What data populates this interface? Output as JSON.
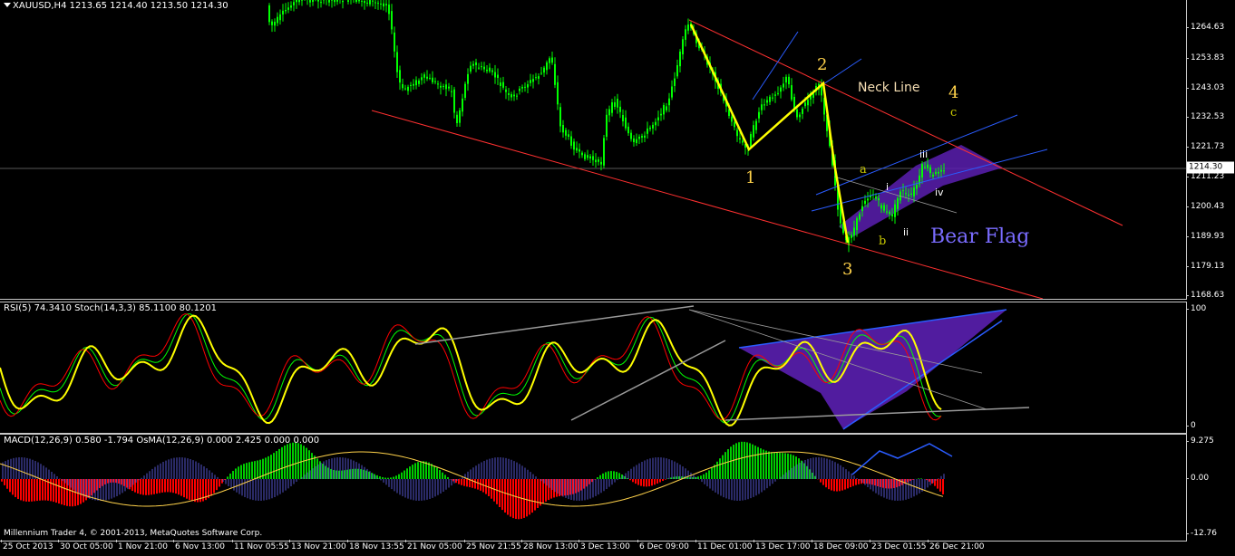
{
  "main": {
    "title": "XAUUSD,H4",
    "ohlc": "1213.65 1214.40 1213.50 1214.30",
    "price_ticks": [
      "1264.63",
      "1253.83",
      "1243.03",
      "1232.53",
      "1221.73",
      "1211.23",
      "1200.43",
      "1189.93",
      "1179.13",
      "1168.63"
    ],
    "current_price": "1214.30",
    "annotations": {
      "neck_line": "Neck Line",
      "bear_flag": "Bear Flag",
      "wave_1": "1",
      "wave_2": "2",
      "wave_3": "3",
      "wave_4": "4",
      "wave_a": "a",
      "wave_b": "b",
      "wave_c": "c",
      "wave_i": "i",
      "wave_ii": "ii",
      "wave_iii": "iii",
      "wave_iv": "iv"
    }
  },
  "rsi_pane": {
    "title": "RSI(5) 74.3410  Stoch(14,3,3) 85.1100 80.1201",
    "ticks": [
      "100",
      "0"
    ]
  },
  "macd_pane": {
    "title": "MACD(12,26,9) 0.580 -1.794  OsMA(12,26,9) 0.000 2.425 0.000 0.000",
    "ticks": [
      "9.275",
      "0.00",
      "-12.76"
    ],
    "copyright": "Millennium Trader 4, © 2001-2013, MetaQuotes Software Corp."
  },
  "time_axis": [
    "25 Oct 2013",
    "30 Oct 05:00",
    "1 Nov 21:00",
    "6 Nov 13:00",
    "11 Nov 05:55",
    "13 Nov 21:00",
    "18 Nov 13:55",
    "21 Nov 05:00",
    "25 Nov 21:55",
    "28 Nov 13:00",
    "3 Dec 13:00",
    "6 Dec 09:00",
    "11 Dec 01:00",
    "13 Dec 17:00",
    "18 Dec 09:00",
    "23 Dec 01:55",
    "26 Dec 21:00"
  ],
  "colors": {
    "bull_candle": "#00ff00",
    "bear_candle": "#00ff00",
    "trend_line": "#ff3030",
    "channel": "#2a5cff",
    "flag_fill": "#5a1fb0",
    "wave_line": "#ffff00",
    "rsi": "#ffff00",
    "stoch_main": "#00ff00",
    "stoch_signal": "#ff0000",
    "macd_pos": "#00cc00",
    "macd_neg": "#ff0000",
    "osma": "#6a6aff"
  }
}
